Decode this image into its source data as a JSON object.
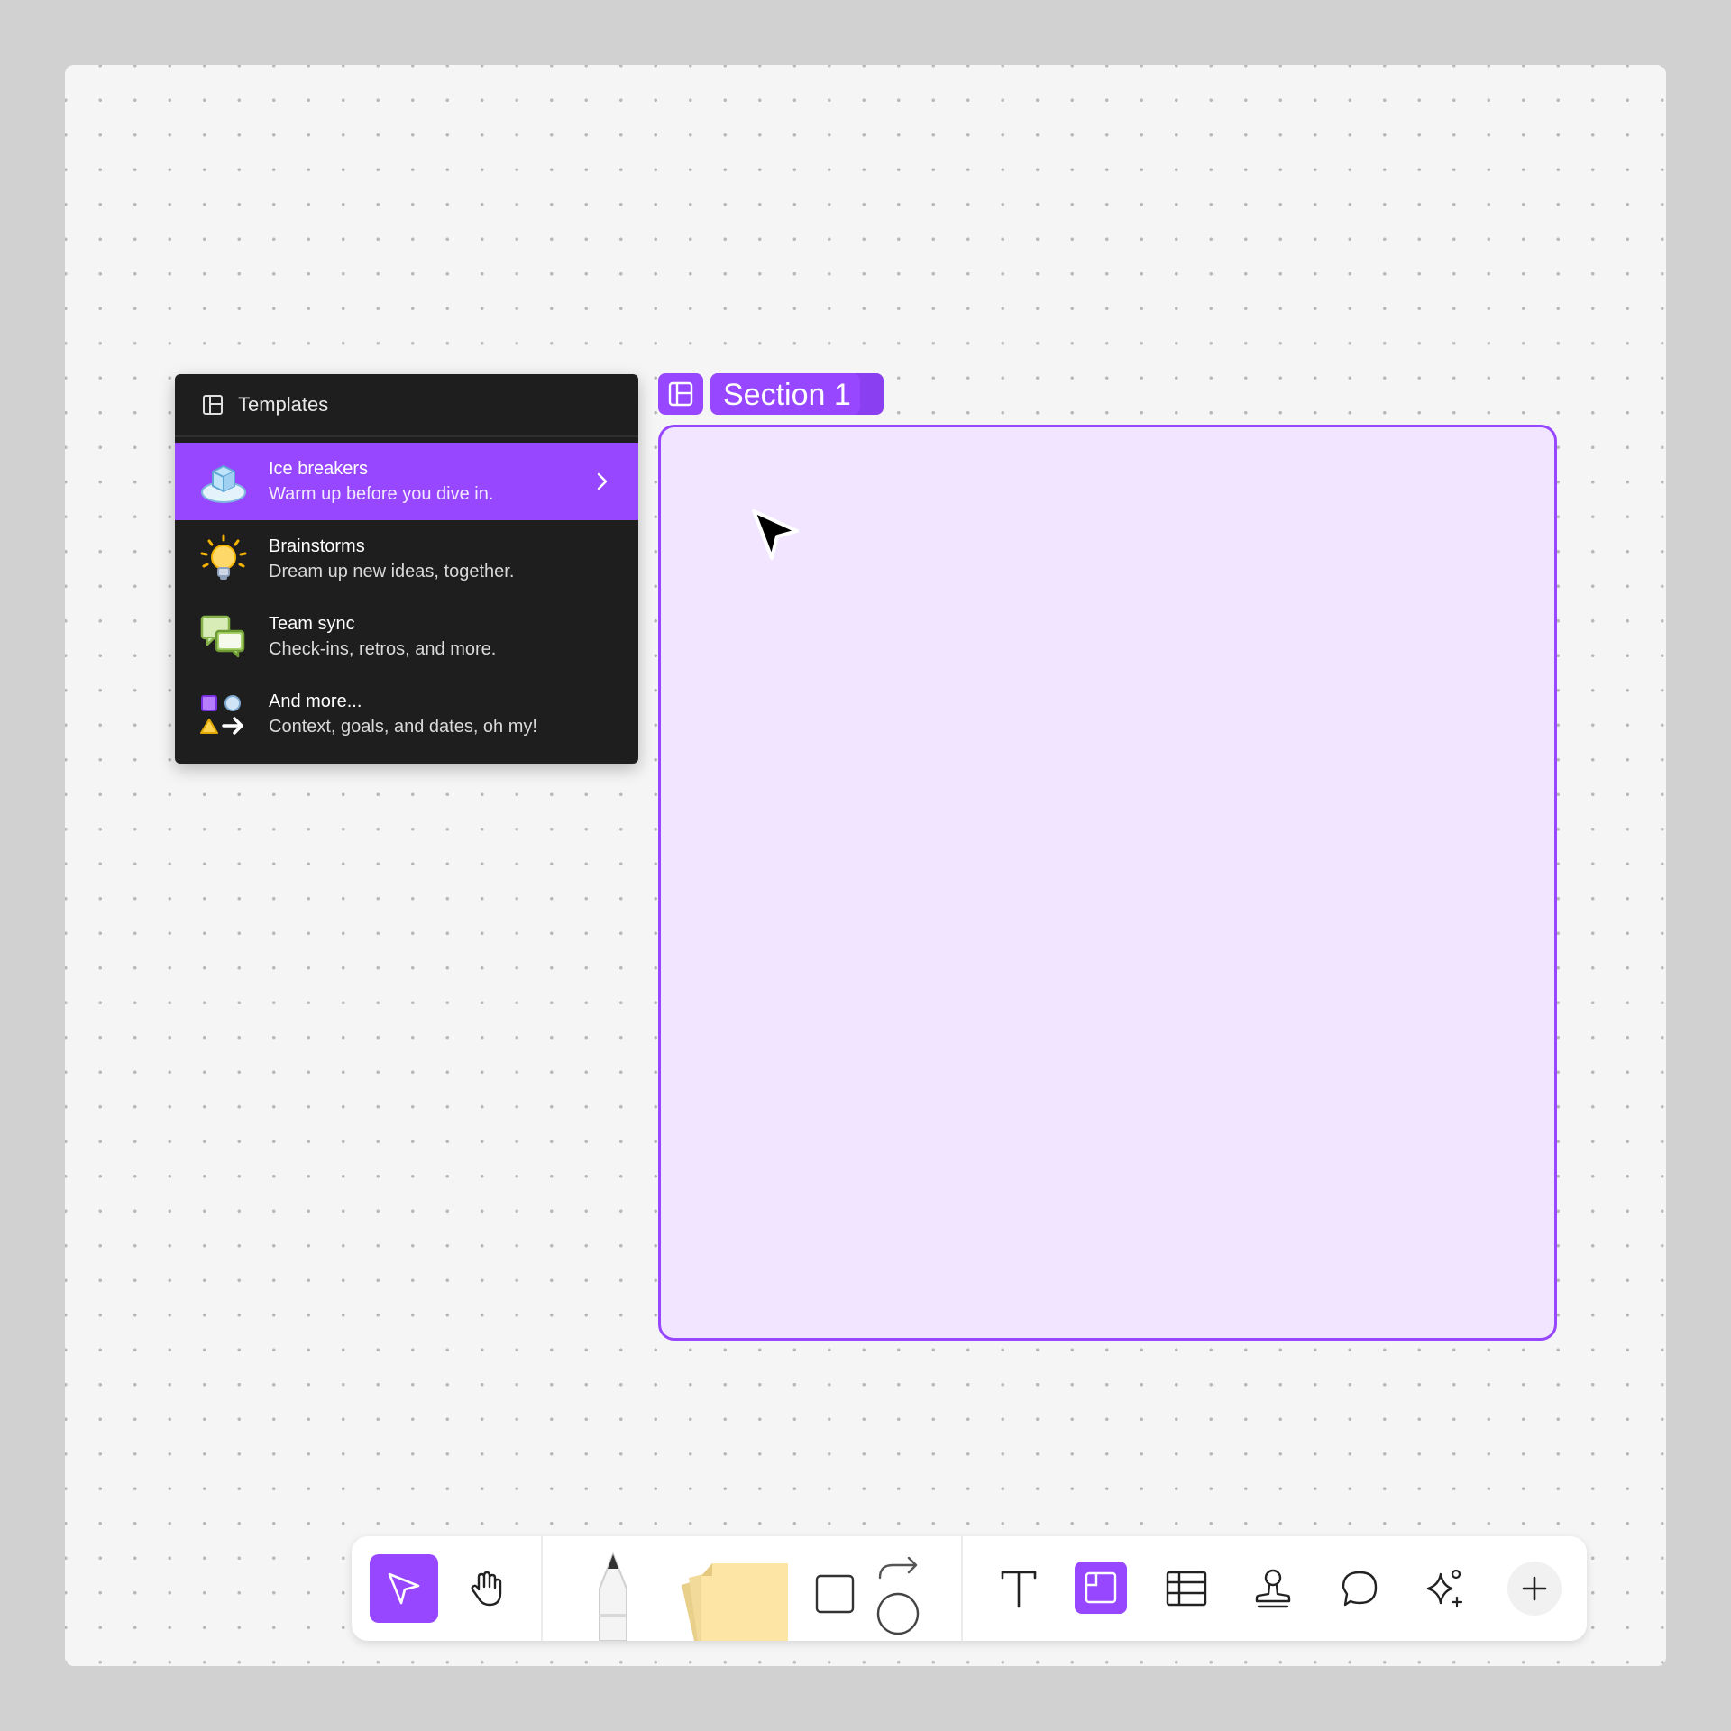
{
  "templates_menu": {
    "title": "Templates",
    "items": [
      {
        "title": "Ice breakers",
        "description": "Warm up before you dive in.",
        "icon": "ice-cube-icon",
        "active": true
      },
      {
        "title": "Brainstorms",
        "description": "Dream up new ideas, together.",
        "icon": "lightbulb-icon",
        "active": false
      },
      {
        "title": "Team sync",
        "description": "Check-ins, retros, and more.",
        "icon": "chat-bubbles-icon",
        "active": false
      },
      {
        "title": "And more...",
        "description": "Context, goals, and dates, oh my!",
        "icon": "shapes-icon",
        "active": false
      }
    ]
  },
  "section": {
    "label": "Section 1"
  },
  "toolbar": {
    "tools": [
      "move-tool",
      "hand-tool",
      "pencil-tool",
      "sticky-note-tool",
      "shape-tool",
      "connector-tool",
      "text-tool",
      "section-tool",
      "table-tool",
      "stamp-tool",
      "comment-tool",
      "ai-tool",
      "more-tool"
    ],
    "active_tools": [
      "move-tool",
      "section-tool"
    ]
  },
  "colors": {
    "accent": "#9747ff",
    "menu_bg": "#1e1e1e",
    "section_fill": "#f1e5ff",
    "canvas_bg": "#f5f5f5",
    "sticky_note": "#fde5a6"
  }
}
